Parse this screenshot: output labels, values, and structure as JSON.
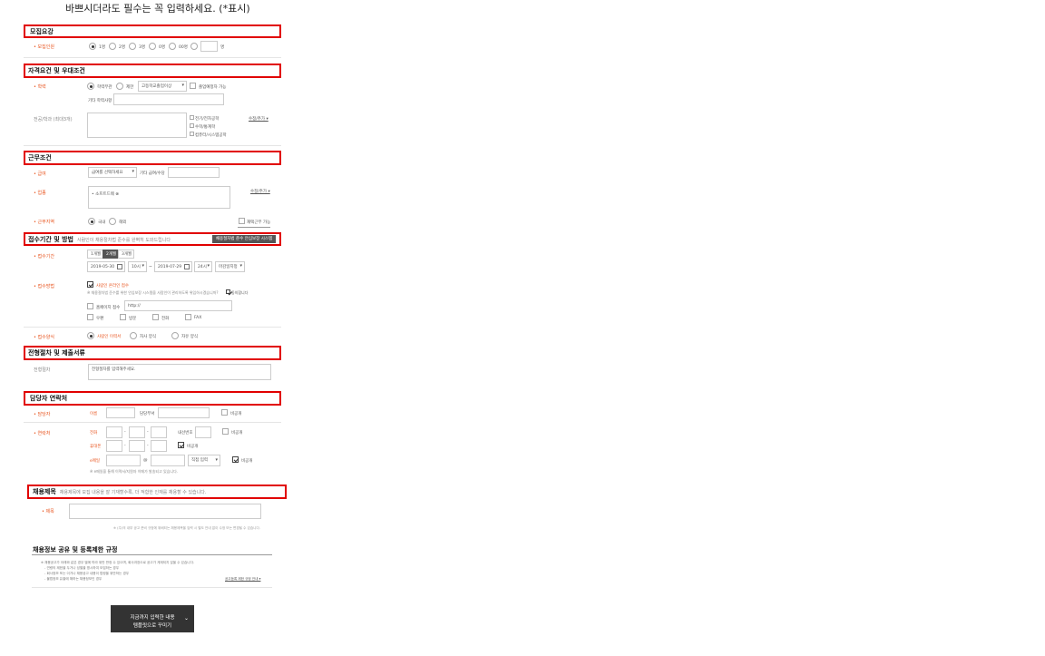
{
  "header": {
    "notice": "바쁘시더라도 필수는 꼭 입력하세요. (*표시)"
  },
  "sec1": {
    "title": "모집요강",
    "label": "• 모집인원",
    "options": [
      "1명",
      "2명",
      "3명",
      "0명",
      "00명"
    ],
    "unit": "명"
  },
  "sec2": {
    "title": "자격요건 및 우대조건",
    "edu_label": "• 학력",
    "edu_opt1": "학력무관",
    "edu_opt2": "제한",
    "edu_select": "고등학교졸업이상",
    "edu_check": "졸업예정자 가능",
    "other_label": "기타 학력사항",
    "major_label": "전공/학과 (최대3개)",
    "major_checks": [
      "전기/전자공학",
      "수학/통계학",
      "컴퓨터/시스템공학"
    ],
    "more_link": "수정/추가 ▾"
  },
  "sec3": {
    "title": "근무조건",
    "pay_label": "• 급여",
    "pay_select": "급여를 선택하세요",
    "pay_other": "기타 급여/수당",
    "job_label": "• 업종",
    "job_item": "• 소프트드웨 ⊗",
    "job_more": "수정/추가 ▾",
    "region_label": "• 근무지역",
    "region_opt1": "국내",
    "region_opt2": "해외",
    "region_check": "재택근무 가능"
  },
  "sec4": {
    "title": "접수기간 및 방법",
    "subtitle": "사람인이 채용절차법 준수를 완벽히 도와드립니다",
    "tag": "채용절차법 준수 안심보장 시스템",
    "period_label": "• 접수기간",
    "tabs": [
      "1개월",
      "2개월",
      "3개월"
    ],
    "start_date": "2019-05-30",
    "start_time": "10시",
    "end_date": "2019-07-29",
    "end_time": "24시",
    "end_type": "마감일지정",
    "method_label": "• 접수방법",
    "online_label": "사람인 온라인 접수",
    "online_note": "※ 채용절차법 준수를 위한 안심보장 시스템을 사람인이 관리하도록 위임하시겠습니까?",
    "agree_label": "동의합니다",
    "homepage_label": "홈페이지 접수",
    "homepage_value": "http://",
    "other_methods": [
      "우편",
      "방문",
      "전화",
      "FAX"
    ],
    "form_label": "• 접수양식",
    "form_opts": [
      "사람인 이력서",
      "자사 양식",
      "자유 양식"
    ]
  },
  "sec5": {
    "title": "전형절차 및 제출서류",
    "label": "전형절차",
    "placeholder": "전형절차를 입력해주세요."
  },
  "sec6": {
    "title": "담당자 연락처",
    "manager_label": "• 담당자",
    "name_label": "이름",
    "dept_label": "담당부서",
    "private": "비공개",
    "contact_label": "• 연락처",
    "phone_label": "전화",
    "ext_label": "내선번호",
    "mobile_label": "휴대폰",
    "email_label": "e메일",
    "email_domain": "직접 입력",
    "at": "@",
    "note": "※ e메일을 통해 이력서/지원자 이메가 발송되고 있습니다."
  },
  "sec7": {
    "title": "채용제목",
    "subtitle": "채용제목에 모집 내용을 잘 기재할수록, 더 적합한 인재를 채용할 수 있습니다.",
    "label": "• 제목",
    "note": "※ (주)의 내부 공고 준비 규정에 위배되는 채용제목을 입력 시 별도 안내 없이 수정 또는 변경될 수 있습니다."
  },
  "sec8": {
    "title": "채용정보 공유 및 등록제한 규정",
    "lines": [
      "※ 채용공고가 아래와 같은 경우 별에 따라 위반 판정 수 있으며, 회사과장으로 공고가 게재되지 않을 수 있습니다.",
      "- 연령의 제한을 두거나 성별을 명시하여 모집하는 경우",
      "- 회사정보 또는 이거나 채용공고 내용이 법령을 위반하는 경우",
      "- 불법정보 유출에 해하는 채용정보인 경우"
    ],
    "link": "공고등록 제한 규정 안내 ▾"
  },
  "footer": {
    "button_line1": "지금까지 입력한 내용",
    "button_line2": "템플릿으로 꾸미기"
  }
}
